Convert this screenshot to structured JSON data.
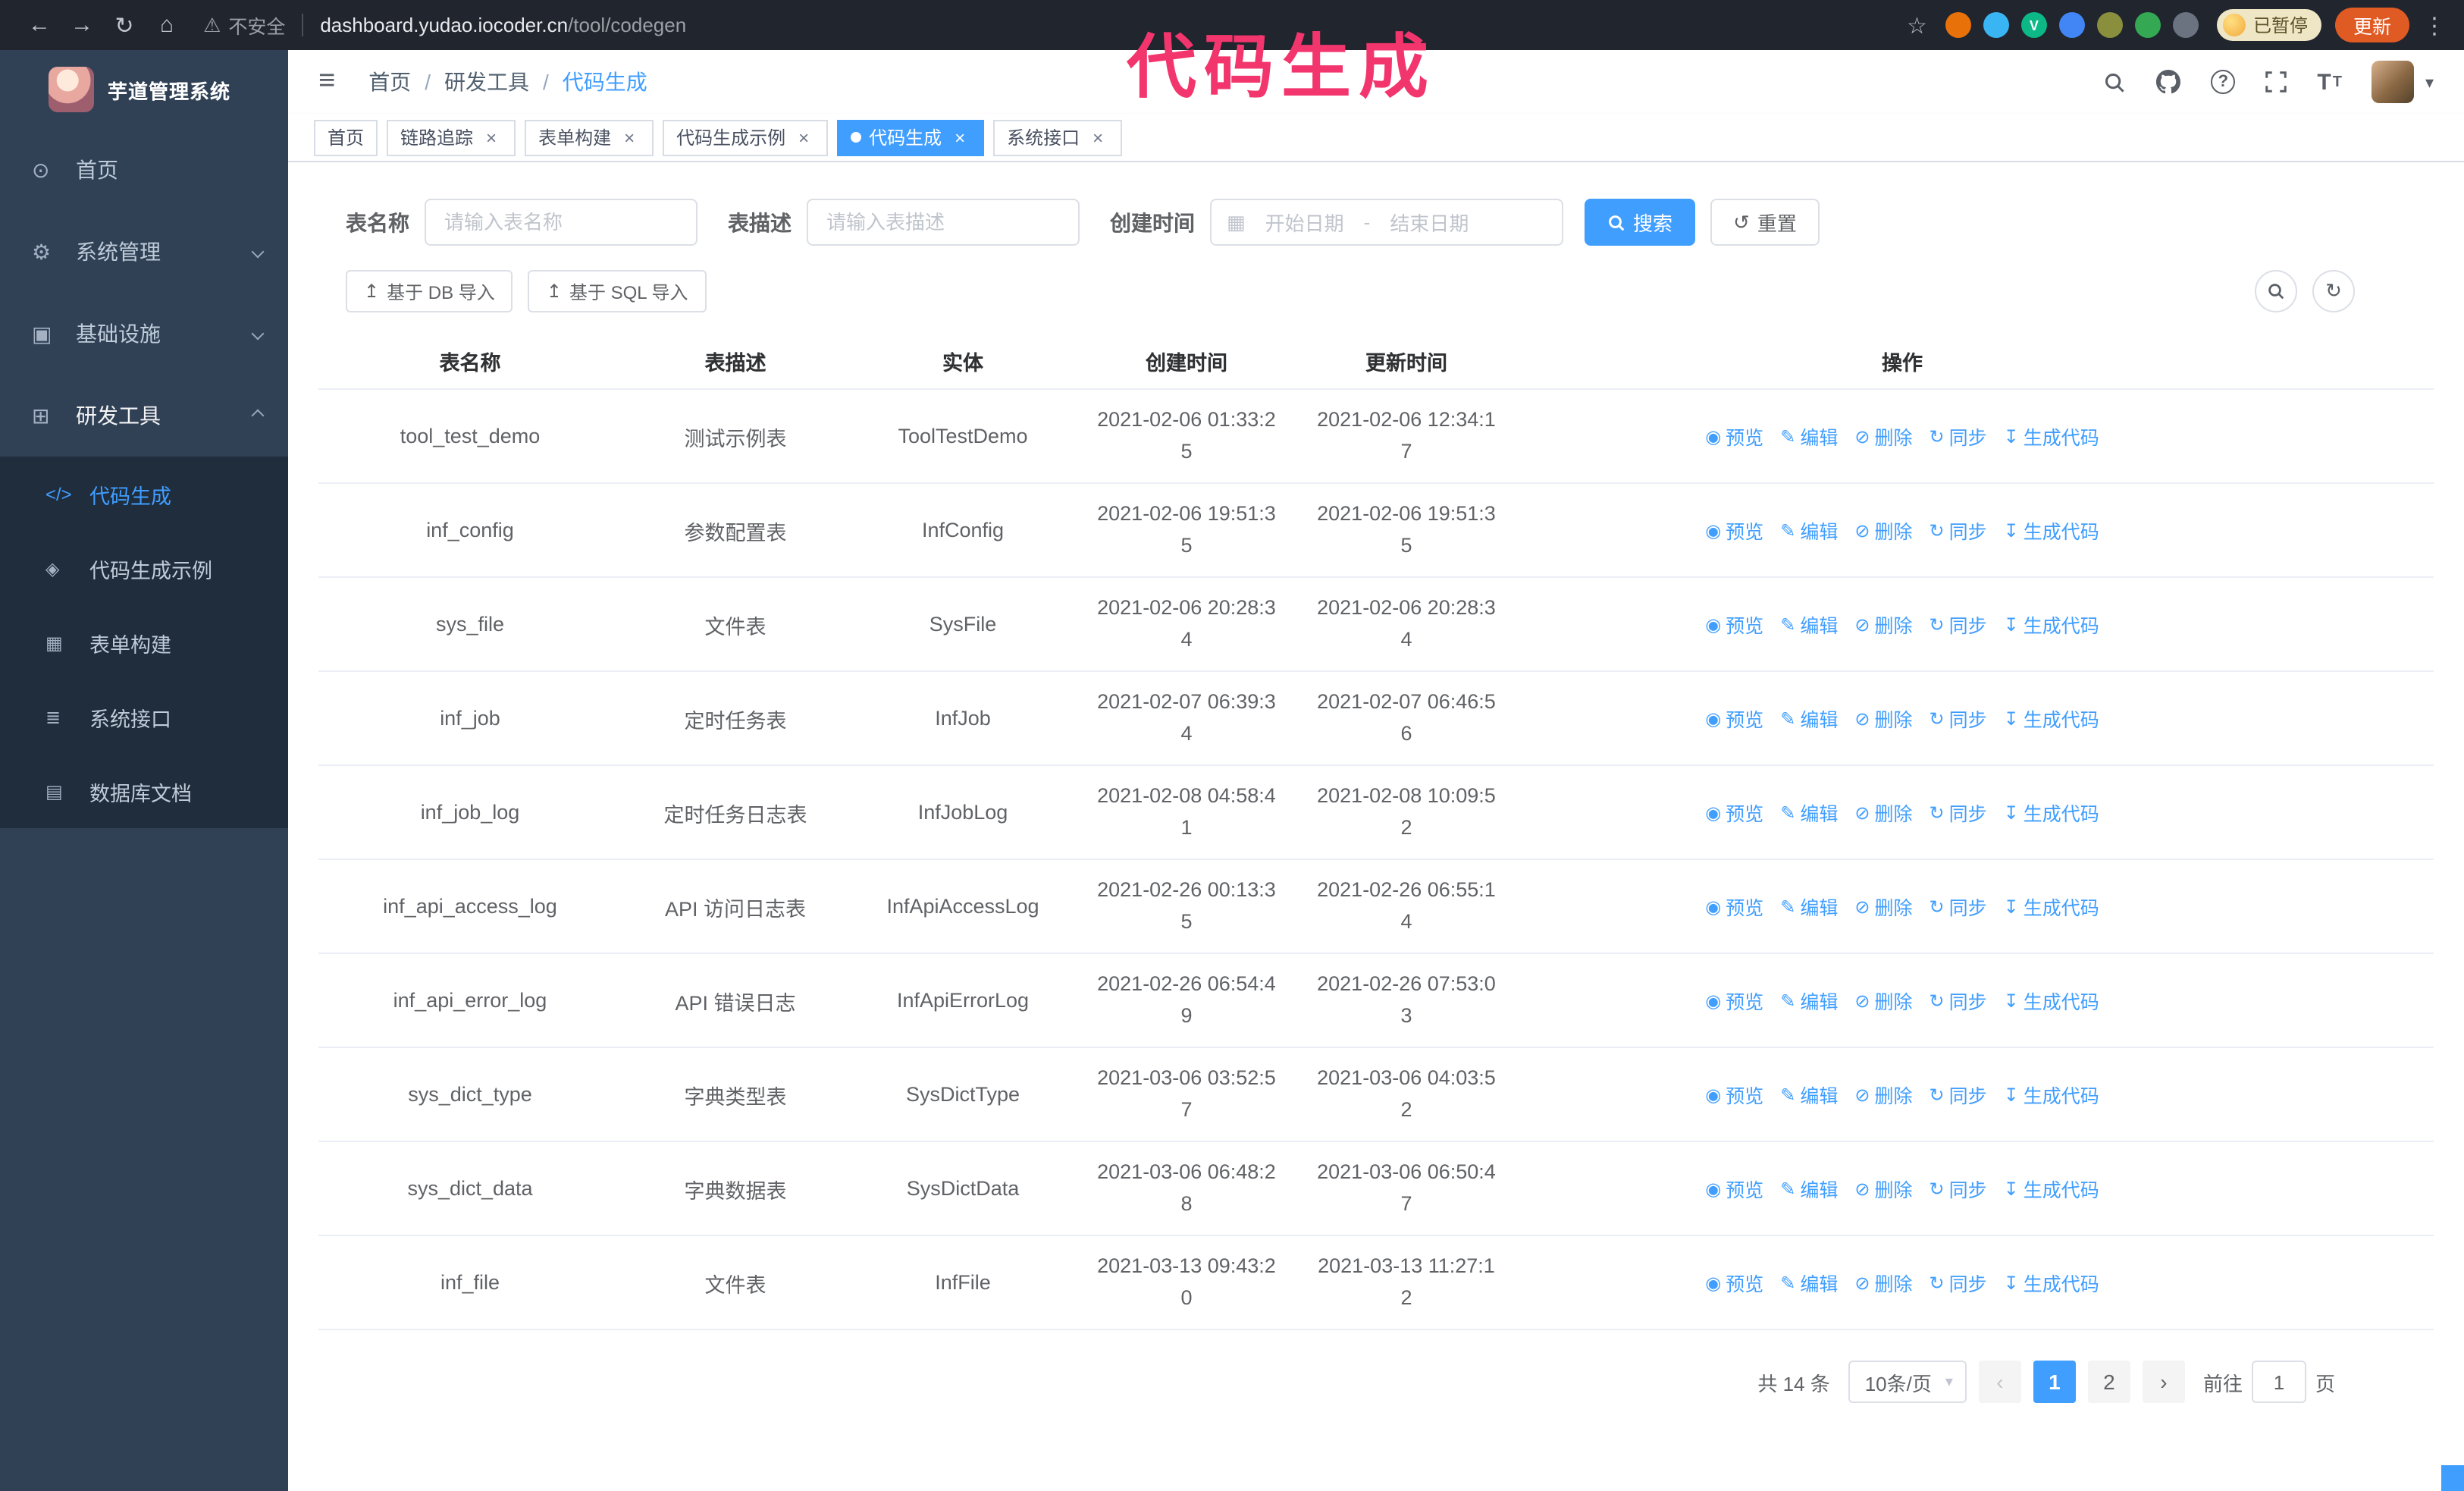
{
  "annotation": {
    "text": "代码生成",
    "color": "#f2356d"
  },
  "browser": {
    "security_label": "不安全",
    "url_host": "dashboard.yudao.iocoder.cn",
    "url_path": "/tool/codegen",
    "paused_badge": "已暂停",
    "update_button": "更新",
    "extensions": [
      {
        "name": "extension-orange",
        "color": "#e8710a",
        "glyph": ""
      },
      {
        "name": "extension-blue-drop",
        "color": "#3ab5f3",
        "glyph": ""
      },
      {
        "name": "extension-green-v",
        "color": "#0cb886",
        "glyph": "V"
      },
      {
        "name": "extension-blue-grid",
        "color": "#4285f4",
        "glyph": ""
      },
      {
        "name": "extension-olive",
        "color": "#8a8f3d",
        "glyph": ""
      },
      {
        "name": "extension-green-leaf",
        "color": "#34a853",
        "glyph": ""
      },
      {
        "name": "extension-puzzle",
        "color": "#6b7280",
        "glyph": ""
      }
    ]
  },
  "sidebar": {
    "logo_title": "芋道管理系统",
    "items": [
      {
        "id": "home",
        "label": "首页",
        "icon": "dashboard",
        "chevron": null,
        "expanded": false
      },
      {
        "id": "system",
        "label": "系统管理",
        "icon": "system",
        "chevron": "down",
        "expanded": false
      },
      {
        "id": "infra",
        "label": "基础设施",
        "icon": "infra",
        "chevron": "down",
        "expanded": false
      },
      {
        "id": "devtools",
        "label": "研发工具",
        "icon": "devtools",
        "chevron": "up",
        "expanded": true
      }
    ],
    "subitems": [
      {
        "id": "codegen",
        "label": "代码生成",
        "icon": "codegen",
        "active": true
      },
      {
        "id": "codegen-example",
        "label": "代码生成示例",
        "icon": "codegen_example",
        "active": false
      },
      {
        "id": "form-builder",
        "label": "表单构建",
        "icon": "form_builder",
        "active": false
      },
      {
        "id": "api",
        "label": "系统接口",
        "icon": "api",
        "active": false
      },
      {
        "id": "db-doc",
        "label": "数据库文档",
        "icon": "db_doc",
        "active": false
      }
    ]
  },
  "header": {
    "breadcrumb": [
      "首页",
      "研发工具",
      "代码生成"
    ],
    "separator": "/"
  },
  "tabs": [
    {
      "id": "home",
      "label": "首页",
      "closable": false,
      "active": false
    },
    {
      "id": "tracer",
      "label": "链路追踪",
      "closable": true,
      "active": false
    },
    {
      "id": "form-builder",
      "label": "表单构建",
      "closable": true,
      "active": false
    },
    {
      "id": "codegen-example",
      "label": "代码生成示例",
      "closable": true,
      "active": false
    },
    {
      "id": "codegen",
      "label": "代码生成",
      "closable": true,
      "active": true
    },
    {
      "id": "api",
      "label": "系统接口",
      "closable": true,
      "active": false
    }
  ],
  "filters": {
    "table_name_label": "表名称",
    "table_name_placeholder": "请输入表名称",
    "table_desc_label": "表描述",
    "table_desc_placeholder": "请输入表描述",
    "create_time_label": "创建时间",
    "date_start": "开始日期",
    "date_separator": "-",
    "date_end": "结束日期",
    "search_button": "搜索",
    "reset_button": "重置"
  },
  "toolbar": {
    "import_db": "基于 DB 导入",
    "import_sql": "基于 SQL 导入"
  },
  "table": {
    "columns": [
      "表名称",
      "表描述",
      "实体",
      "创建时间",
      "更新时间",
      "操作"
    ],
    "actions": [
      "预览",
      "编辑",
      "删除",
      "同步",
      "生成代码"
    ],
    "rows": [
      {
        "name": "tool_test_demo",
        "desc": "测试示例表",
        "entity": "ToolTestDemo",
        "created": "2021-02-06 01:33:25",
        "updated": "2021-02-06 12:34:17"
      },
      {
        "name": "inf_config",
        "desc": "参数配置表",
        "entity": "InfConfig",
        "created": "2021-02-06 19:51:35",
        "updated": "2021-02-06 19:51:35"
      },
      {
        "name": "sys_file",
        "desc": "文件表",
        "entity": "SysFile",
        "created": "2021-02-06 20:28:34",
        "updated": "2021-02-06 20:28:34"
      },
      {
        "name": "inf_job",
        "desc": "定时任务表",
        "entity": "InfJob",
        "created": "2021-02-07 06:39:34",
        "updated": "2021-02-07 06:46:56"
      },
      {
        "name": "inf_job_log",
        "desc": "定时任务日志表",
        "entity": "InfJobLog",
        "created": "2021-02-08 04:58:41",
        "updated": "2021-02-08 10:09:52"
      },
      {
        "name": "inf_api_access_log",
        "desc": "API 访问日志表",
        "entity": "InfApiAccessLog",
        "created": "2021-02-26 00:13:35",
        "updated": "2021-02-26 06:55:14"
      },
      {
        "name": "inf_api_error_log",
        "desc": "API 错误日志",
        "entity": "InfApiErrorLog",
        "created": "2021-02-26 06:54:49",
        "updated": "2021-02-26 07:53:03"
      },
      {
        "name": "sys_dict_type",
        "desc": "字典类型表",
        "entity": "SysDictType",
        "created": "2021-03-06 03:52:57",
        "updated": "2021-03-06 04:03:52"
      },
      {
        "name": "sys_dict_data",
        "desc": "字典数据表",
        "entity": "SysDictData",
        "created": "2021-03-06 06:48:28",
        "updated": "2021-03-06 06:50:47"
      },
      {
        "name": "inf_file",
        "desc": "文件表",
        "entity": "InfFile",
        "created": "2021-03-13 09:43:20",
        "updated": "2021-03-13 11:27:12"
      }
    ]
  },
  "pagination": {
    "total": "共 14 条",
    "page_size": "10条/页",
    "pages": [
      "1",
      "2"
    ],
    "active_page": "1",
    "goto_label": "前往",
    "goto_value": "1",
    "goto_suffix": "页"
  },
  "colors": {
    "accent": "#409eff",
    "sidebar_bg": "#304156",
    "submenu_bg": "#1f2d3d",
    "update_button_bg": "#e05a24",
    "annotation": "#f2356d"
  },
  "icons": {
    "back": "←",
    "forward": "→",
    "reload": "↻",
    "home": "⌂",
    "warning": "⚠",
    "star": "☆",
    "kebab": "⋮",
    "hamburger": "≡",
    "caret": "▾",
    "close": "×",
    "chevron_left": "‹",
    "chevron_right": "›",
    "dashboard": "⊙",
    "system": "⚙",
    "infra": "▣",
    "devtools": "⊞",
    "codegen": "</>",
    "codegen_example": "◈",
    "form_builder": "▦",
    "api": "≣",
    "db_doc": "▤",
    "calendar": "▦",
    "eye": "◉",
    "edit": "✎",
    "delete": "⊘",
    "sync": "↻",
    "download": "↧",
    "upload": "↥",
    "reset": "↺"
  }
}
